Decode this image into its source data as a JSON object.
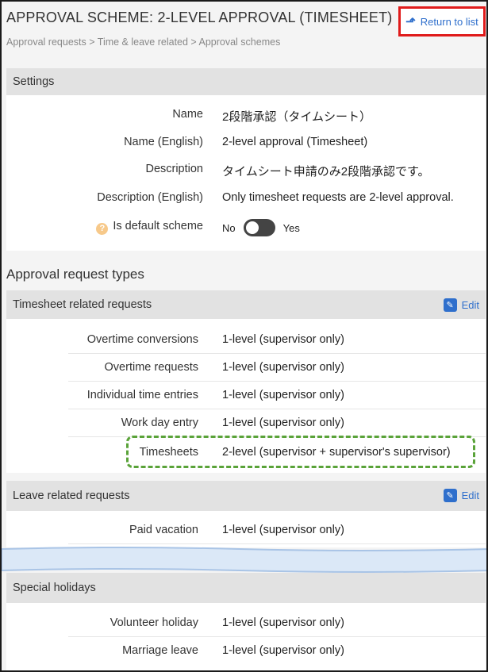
{
  "header": {
    "title": "APPROVAL SCHEME: 2-LEVEL APPROVAL (TIMESHEET)",
    "breadcrumb": "Approval requests > Time & leave related > Approval schemes",
    "return_label": "Return to list"
  },
  "settings": {
    "section_title": "Settings",
    "rows": [
      {
        "label": "Name",
        "value": "2段階承認（タイムシート）"
      },
      {
        "label": "Name (English)",
        "value": "2-level approval (Timesheet)"
      },
      {
        "label": "Description",
        "value": "タイムシート申請のみ2段階承認です。"
      },
      {
        "label": "Description (English)",
        "value": "Only timesheet requests are 2-level approval."
      }
    ],
    "default_scheme": {
      "label": "Is default scheme",
      "help_icon": "?",
      "no_label": "No",
      "yes_label": "Yes"
    }
  },
  "approval_types": {
    "heading": "Approval request types",
    "edit_label": "Edit",
    "timesheet_group": {
      "title": "Timesheet related requests",
      "rows": [
        {
          "label": "Overtime conversions",
          "value": "1-level (supervisor only)"
        },
        {
          "label": "Overtime requests",
          "value": "1-level (supervisor only)"
        },
        {
          "label": "Individual time entries",
          "value": "1-level (supervisor only)"
        },
        {
          "label": "Work day entry",
          "value": "1-level (supervisor only)"
        },
        {
          "label": "Timesheets",
          "value": "2-level (supervisor + supervisor's supervisor)"
        }
      ]
    },
    "leave_group": {
      "title": "Leave related requests",
      "rows": [
        {
          "label": "Paid vacation",
          "value": "1-level (supervisor only)"
        }
      ]
    },
    "special_group": {
      "title": "Special holidays",
      "rows": [
        {
          "label": "Volunteer holiday",
          "value": "1-level (supervisor only)"
        },
        {
          "label": "Marriage leave",
          "value": "1-level (supervisor only)"
        }
      ]
    }
  },
  "colors": {
    "link": "#2f6fcc",
    "return_border": "#e01b1b",
    "highlight": "#5aa339",
    "break_band": "#dbe8f7"
  }
}
